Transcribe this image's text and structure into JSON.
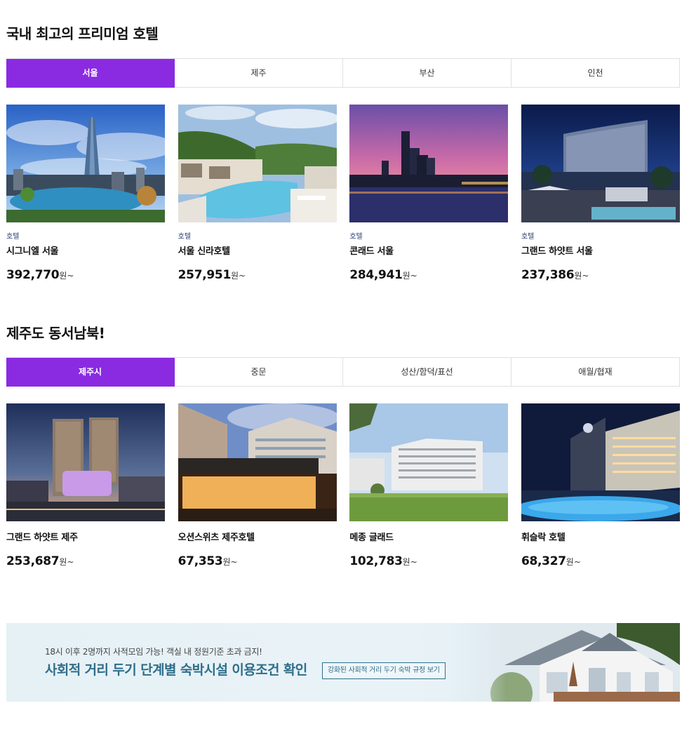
{
  "premium": {
    "title": "국내 최고의 프리미엄 호텔",
    "tabs": [
      "서울",
      "제주",
      "부산",
      "인천"
    ],
    "active_tab": "서울",
    "hotels": [
      {
        "category": "호텔",
        "name": "시그니엘 서울",
        "price": "392,770",
        "unit": "원~"
      },
      {
        "category": "호텔",
        "name": "서울 신라호텔",
        "price": "257,951",
        "unit": "원~"
      },
      {
        "category": "호텔",
        "name": "콘래드 서울",
        "price": "284,941",
        "unit": "원~"
      },
      {
        "category": "호텔",
        "name": "그랜드 하얏트 서울",
        "price": "237,386",
        "unit": "원~"
      }
    ]
  },
  "jeju": {
    "title": "제주도 동서남북!",
    "tabs": [
      "제주시",
      "중문",
      "성산/함덕/표선",
      "애월/협재"
    ],
    "active_tab": "제주시",
    "hotels": [
      {
        "name": "그랜드 하얏트 제주",
        "price": "253,687",
        "unit": "원~"
      },
      {
        "name": "오션스위츠 제주호텔",
        "price": "67,353",
        "unit": "원~"
      },
      {
        "name": "메종 글래드",
        "price": "102,783",
        "unit": "원~"
      },
      {
        "name": "휘슬락 호텔",
        "price": "68,327",
        "unit": "원~"
      }
    ]
  },
  "banner": {
    "subtitle": "18시 이후 2명까지 사적모임 가능! 객실 내 정원기준 초과 금지!",
    "headline": "사회적 거리 두기 단계별 숙박시설 이용조건 확인",
    "button": "강화된 사회적 거리 두기 숙박 규정 보기"
  },
  "colors": {
    "accent": "#8a2be2",
    "banner_text": "#2f6e8a"
  }
}
